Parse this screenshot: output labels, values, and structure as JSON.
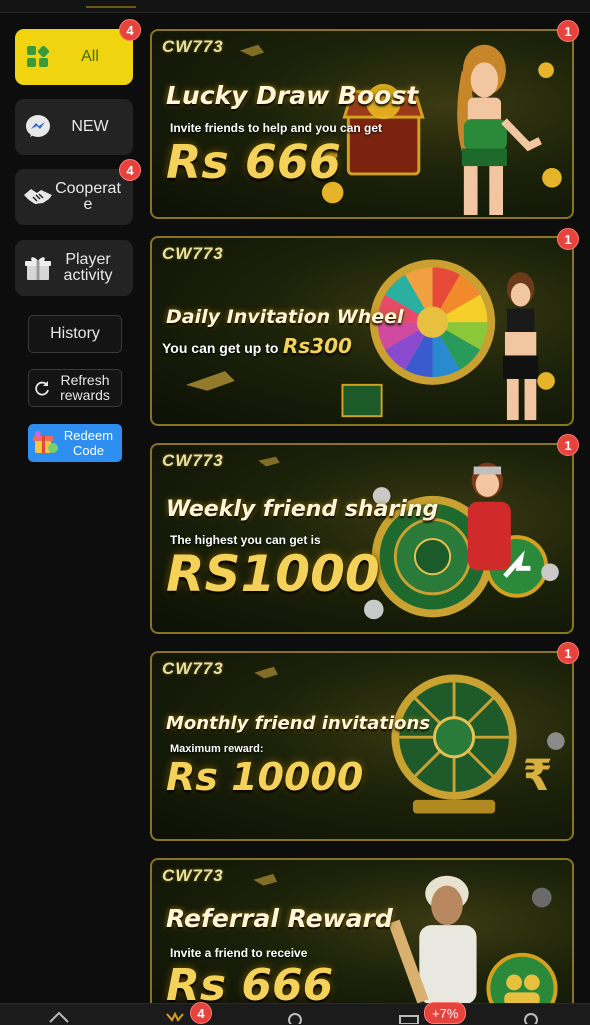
{
  "sidebar": {
    "items": [
      {
        "label": "All",
        "icon": "grid-icon",
        "badge": "4",
        "active": true
      },
      {
        "label": "NEW",
        "icon": "messenger-icon"
      },
      {
        "label": "Cooperat e",
        "icon": "handshake-icon",
        "badge": "4"
      },
      {
        "label": "Player activity",
        "icon": "gift-icon"
      }
    ],
    "history_label": "History",
    "refresh_label": "Refresh rewards",
    "redeem_label": "Redeem Code"
  },
  "banners": [
    {
      "logo": "CW773",
      "title": "Lucky Draw Boost",
      "subtitle": "Invite friends to help and you can get",
      "amount": "Rs 666",
      "badge": "1"
    },
    {
      "logo": "CW773",
      "title": "Daily Invitation Wheel",
      "subtitle": "You can get up to",
      "amount": "Rs300",
      "badge": "1"
    },
    {
      "logo": "CW773",
      "title": "Weekly friend sharing",
      "subtitle": "The highest you can get is",
      "amount": "RS1000",
      "badge": "1"
    },
    {
      "logo": "CW773",
      "title": "Monthly friend invitations",
      "subtitle": "Maximum reward:",
      "amount": "Rs 10000",
      "badge": "1"
    },
    {
      "logo": "CW773",
      "title": "Referral Reward",
      "subtitle": "Invite a friend to receive",
      "amount": "Rs 666"
    }
  ],
  "bottom_nav": {
    "badge": "4",
    "percent_badge": "+7%"
  },
  "colors": {
    "accent_yellow": "#f0d40f",
    "badge_red": "#e5433c",
    "redeem_blue": "#2f8ff0",
    "gold_text": "#f4d25a"
  }
}
